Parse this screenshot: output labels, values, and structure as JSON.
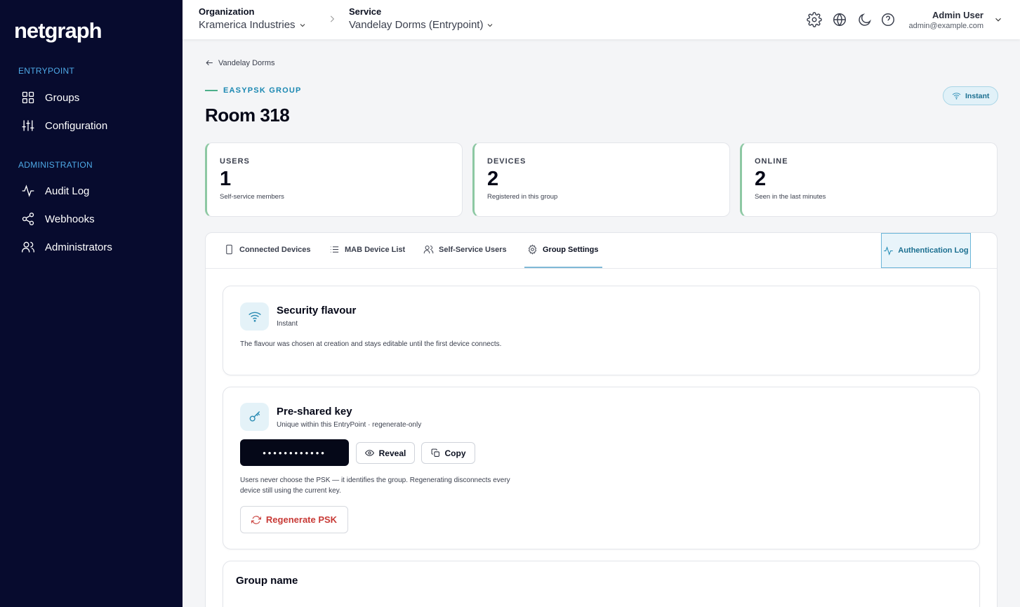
{
  "sidebar": {
    "logo": "netgraph",
    "sections": [
      {
        "title": "ENTRYPOINT",
        "items": [
          {
            "label": "Groups",
            "icon": "grid-icon"
          },
          {
            "label": "Configuration",
            "icon": "sliders-icon"
          }
        ]
      },
      {
        "title": "ADMINISTRATION",
        "items": [
          {
            "label": "Audit Log",
            "icon": "activity-icon"
          },
          {
            "label": "Webhooks",
            "icon": "share-icon"
          },
          {
            "label": "Administrators",
            "icon": "users-icon"
          }
        ]
      }
    ]
  },
  "header": {
    "org_label": "Organization",
    "org_value": "Kramerica Industries",
    "service_label": "Service",
    "service_value": "Vandelay Dorms (Entrypoint)",
    "user_name": "Admin User",
    "user_email": "admin@example.com"
  },
  "page": {
    "back_label": "Vandelay Dorms",
    "eyebrow": "EASYPSK GROUP",
    "title": "Room 318",
    "badge": "Instant"
  },
  "stats": [
    {
      "label": "USERS",
      "value": "1",
      "sub": "Self-service members"
    },
    {
      "label": "DEVICES",
      "value": "2",
      "sub": "Registered in this group"
    },
    {
      "label": "ONLINE",
      "value": "2",
      "sub": "Seen in the last minutes"
    }
  ],
  "tabs": [
    {
      "label": "Connected Devices",
      "icon": "phone-icon"
    },
    {
      "label": "MAB Device List",
      "icon": "list-icon"
    },
    {
      "label": "Self-Service Users",
      "icon": "users-icon"
    },
    {
      "label": "Group Settings",
      "icon": "gear-icon",
      "active": true
    }
  ],
  "auth_log_label": "Authentication Log",
  "security": {
    "title": "Security flavour",
    "sub": "Instant",
    "desc": "The flavour was chosen at creation and stays editable until the first device connects."
  },
  "psk": {
    "title": "Pre-shared key",
    "sub": "Unique within this EntryPoint · regenerate-only",
    "masked": "••••••••••••",
    "reveal_label": "Reveal",
    "copy_label": "Copy",
    "desc": "Users never choose the PSK — it identifies the group. Regenerating disconnects every device still using the current key.",
    "regen_label": "Regenerate PSK"
  },
  "group_name": {
    "title": "Group name"
  },
  "colors": {
    "sidebar_bg": "#070b2e",
    "accent": "#1b88b2",
    "danger": "#c83a36",
    "stat_border": "#8dc8a3"
  }
}
